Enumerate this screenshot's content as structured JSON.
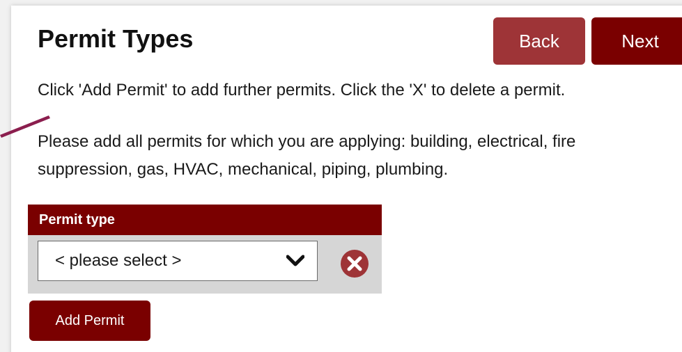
{
  "page": {
    "title": "Permit Types"
  },
  "nav": {
    "back_label": "Back",
    "next_label": "Next"
  },
  "instructions": {
    "line1": "Click 'Add Permit' to add further permits. Click the 'X' to delete a permit.",
    "line2a": "Please add all permits for which you are applying: building, electrical, fire",
    "line2b": "suppression, gas, HVAC, mechanical, piping, plumbing."
  },
  "permit_table": {
    "header": "Permit type",
    "rows": [
      {
        "select_value": "< please select >"
      }
    ]
  },
  "actions": {
    "add_label": "Add Permit"
  },
  "colors": {
    "primary": "#7a0000",
    "back_button": "#9e3437",
    "delete_icon": "#9e3437",
    "table_bg": "#d6d6d6"
  },
  "icons": {
    "dropdown": "chevron-down-icon",
    "delete": "close-circle-icon"
  }
}
